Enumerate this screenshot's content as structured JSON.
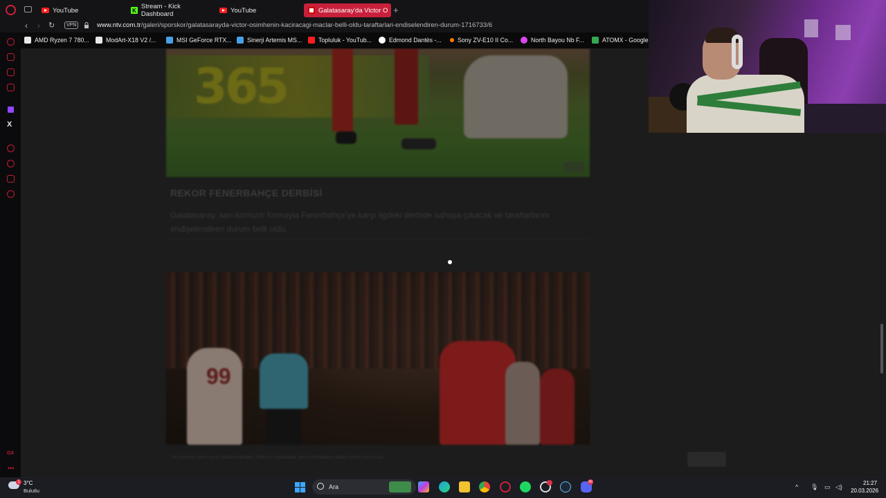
{
  "tabs": [
    {
      "label": "YouTube",
      "favicon": "youtube-icon"
    },
    {
      "label": "Stream - Kick Dashboard",
      "favicon": "kick-icon"
    },
    {
      "label": "YouTube",
      "favicon": "youtube-icon"
    },
    {
      "label": "Galatasaray'da Victor Osir",
      "favicon": "ntv-icon",
      "active": true
    }
  ],
  "address": {
    "vpn_label": "VPN",
    "url_domain": "www.ntv.com.tr",
    "url_path": "/galeri/sporskor/galatasarayda-victor-osimhenin-kaciracagi-maclar-belli-oldu-taraftarlari-endiselendiren-durum-1716733/6"
  },
  "bookmarks": [
    {
      "label": "AMD Ryzen 7 780...",
      "color": "#e8e8e8"
    },
    {
      "label": "ModArt-X18 V2 /...",
      "color": "#e8e8e8"
    },
    {
      "label": "MSI GeForce RTX...",
      "color": "#4aa0e6"
    },
    {
      "label": "Sinerji Artemis MS...",
      "color": "#4aa0e6"
    },
    {
      "label": "Topluluk - YouTub...",
      "color": "#ff1e1e"
    },
    {
      "label": "Edmond Dantès -...",
      "color": "#ffffff"
    },
    {
      "label": "Sony ZV-E10 II Co...",
      "color": "#ff7a00"
    },
    {
      "label": "North Bayou Nb F...",
      "color": "#d946ef"
    },
    {
      "label": "ATOMX - Google...",
      "color": "#34a853"
    }
  ],
  "page": {
    "headline": "REKOR FENERBAHÇE DERBİSİ",
    "description": "Galatasaray, sarı-kırmızılı formayla Fenerbahçe'ye karşı ligdeki derbide sahaya çıkacak ve taraftarlarını endişelendiren durum belli oldu.",
    "footer_note": "Bu internet sitesi çerez kullanmaktadır. Sitemizi kullanarak çerez politikamızı kabul etmiş olursunuz.",
    "photo1_number": "365"
  },
  "taskbar": {
    "weather_temp": "3°C",
    "weather_desc": "Bulutlu",
    "weather_badge": "1",
    "search_placeholder": "Ara",
    "time": "21:27",
    "date": "20.03.2026",
    "discord_badge": "99"
  }
}
